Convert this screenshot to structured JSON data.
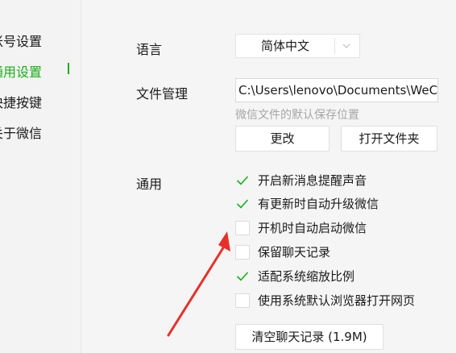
{
  "sidebar": {
    "items": [
      {
        "label": "账号设置"
      },
      {
        "label": "通用设置"
      },
      {
        "label": "快捷按键"
      },
      {
        "label": "关于微信"
      }
    ]
  },
  "language": {
    "label": "语言",
    "selected": "简体中文"
  },
  "file_management": {
    "label": "文件管理",
    "path": "C:\\Users\\lenovo\\Documents\\WeChat Files",
    "hint": "微信文件的默认保存位置",
    "change_label": "更改",
    "open_folder_label": "打开文件夹"
  },
  "general": {
    "label": "通用",
    "options": [
      {
        "label": "开启新消息提醒声音",
        "checked": true
      },
      {
        "label": "有更新时自动升级微信",
        "checked": true
      },
      {
        "label": "开机时自动启动微信",
        "checked": false
      },
      {
        "label": "保留聊天记录",
        "checked": false
      },
      {
        "label": "适配系统缩放比例",
        "checked": true
      },
      {
        "label": "使用系统默认浏览器打开网页",
        "checked": false
      }
    ],
    "clear_label": "清空聊天记录 (1.9M)"
  },
  "colors": {
    "accent": "#1aad19",
    "annotation_arrow": "#e8302a"
  }
}
